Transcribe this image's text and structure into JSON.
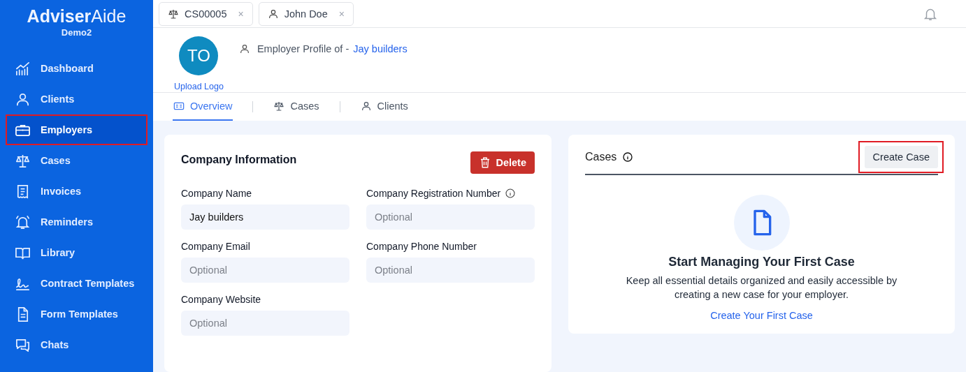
{
  "brand": {
    "name_bold": "Adviser",
    "name_light": "Aide",
    "org": "Demo2"
  },
  "sidebar": {
    "items": [
      {
        "label": "Dashboard",
        "selected": false,
        "highlighted": false
      },
      {
        "label": "Clients",
        "selected": false,
        "highlighted": false
      },
      {
        "label": "Employers",
        "selected": true,
        "highlighted": true
      },
      {
        "label": "Cases",
        "selected": false,
        "highlighted": false
      },
      {
        "label": "Invoices",
        "selected": false,
        "highlighted": false
      },
      {
        "label": "Reminders",
        "selected": false,
        "highlighted": false
      },
      {
        "label": "Library",
        "selected": false,
        "highlighted": false
      },
      {
        "label": "Contract Templates",
        "selected": false,
        "highlighted": false
      },
      {
        "label": "Form Templates",
        "selected": false,
        "highlighted": false
      },
      {
        "label": "Chats",
        "selected": false,
        "highlighted": false
      }
    ]
  },
  "open_tabs": [
    {
      "label": "CS00005",
      "kind": "case",
      "close": "×"
    },
    {
      "label": "John Doe",
      "kind": "client",
      "close": "×"
    }
  ],
  "profile": {
    "avatar_initials": "TO",
    "upload_label": "Upload Logo",
    "title_prefix": "Employer Profile of -",
    "employer_name": "Jay builders"
  },
  "profile_tabs": [
    {
      "label": "Overview",
      "kind": "overview",
      "selected": true
    },
    {
      "label": "Cases",
      "kind": "case",
      "selected": false
    },
    {
      "label": "Clients",
      "kind": "client",
      "selected": false
    }
  ],
  "company_card": {
    "title": "Company Information",
    "delete_button": "Delete",
    "fields": [
      {
        "label": "Company Name",
        "value": "Jay builders",
        "info": false
      },
      {
        "label": "Company Registration Number",
        "placeholder": "Optional",
        "info": true
      },
      {
        "label": "Company Email",
        "placeholder": "Optional",
        "info": false
      },
      {
        "label": "Company Phone Number",
        "placeholder": "Optional",
        "info": false
      },
      {
        "label": "Company Website",
        "placeholder": "Optional",
        "info": false
      }
    ]
  },
  "cases_card": {
    "title": "Cases",
    "create_button": "Create Case",
    "create_button_highlighted": true,
    "empty_title": "Start Managing Your First Case",
    "empty_text": "Keep all essential details organized and easily accessible by creating a new case for your employer.",
    "empty_link": "Create Your First Case"
  }
}
